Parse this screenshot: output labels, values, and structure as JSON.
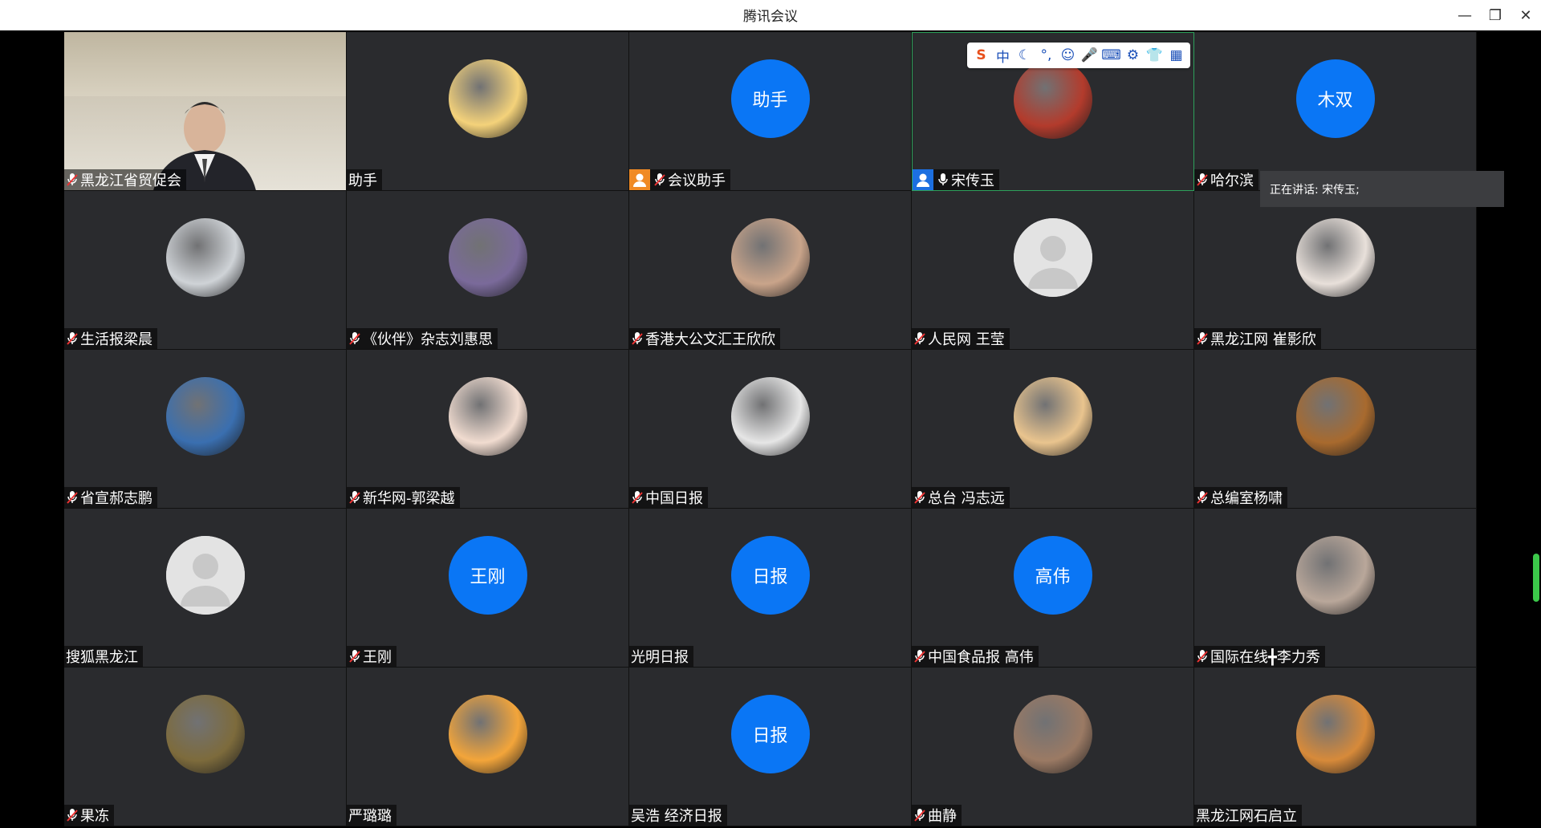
{
  "window": {
    "title": "腾讯会议",
    "controls": {
      "minimize": "—",
      "restore": "❐",
      "close": "✕"
    }
  },
  "speaking": {
    "label": "正在讲话: 宋传玉;"
  },
  "ime": {
    "logo": "S",
    "mode": "中",
    "moon": "☾",
    "punct": "°,",
    "emoji": "☺",
    "voice": "🎤",
    "keyboard": "⌨",
    "tools": "⚙",
    "skin": "👕",
    "more": "▦"
  },
  "participants": [
    {
      "name": "黑龙江省贸促会",
      "avatar": "video",
      "mic": true
    },
    {
      "name": "助手",
      "avatar": "image",
      "color": "#f4d27a",
      "mic": false
    },
    {
      "name": "会议助手",
      "avatar": "text",
      "avatar_text": "助手",
      "mic": true,
      "badge": true
    },
    {
      "name": "宋传玉",
      "avatar": "image",
      "color": "#b33b2c",
      "mic": true,
      "badge": true,
      "active": true
    },
    {
      "name": "哈尔滨",
      "avatar": "text",
      "avatar_text": "木双",
      "mic": true
    },
    {
      "name": "生活报梁晨",
      "avatar": "image",
      "color": "#cfd3d7",
      "mic": true
    },
    {
      "name": "《伙伴》杂志刘惠思",
      "avatar": "image",
      "color": "#7a6a9a",
      "mic": true
    },
    {
      "name": "香港大公文汇王欣欣",
      "avatar": "image",
      "color": "#c9a48a",
      "mic": true
    },
    {
      "name": "人民网 王莹",
      "avatar": "default",
      "mic": true
    },
    {
      "name": "黑龙江网 崔影欣",
      "avatar": "image",
      "color": "#e8e0da",
      "mic": true
    },
    {
      "name": "省宣郝志鹏",
      "avatar": "image",
      "color": "#3a6fb0",
      "mic": true
    },
    {
      "name": "新华网-郭梁越",
      "avatar": "image",
      "color": "#f1dcd0",
      "mic": true
    },
    {
      "name": "中国日报",
      "avatar": "image",
      "color": "#e6e6e6",
      "mic": true
    },
    {
      "name": "总台 冯志远",
      "avatar": "image",
      "color": "#e9c48e",
      "mic": true
    },
    {
      "name": "总编室杨啸",
      "avatar": "image",
      "color": "#a86a2e",
      "mic": true
    },
    {
      "name": "搜狐黑龙江",
      "avatar": "default",
      "mic": false
    },
    {
      "name": "王刚",
      "avatar": "text",
      "avatar_text": "王刚",
      "mic": true
    },
    {
      "name": "光明日报",
      "avatar": "text",
      "avatar_text": "日报",
      "mic": false
    },
    {
      "name": "中国食品报 高伟",
      "avatar": "text",
      "avatar_text": "高伟",
      "mic": true
    },
    {
      "name": "国际在线╋李力秀",
      "avatar": "image",
      "color": "#b9a79a",
      "mic": true
    },
    {
      "name": "果冻",
      "avatar": "image",
      "color": "#7d6b3c",
      "mic": true
    },
    {
      "name": "严璐璐",
      "avatar": "image",
      "color": "#f3a53a",
      "mic": false
    },
    {
      "name": "吴浩 经济日报",
      "avatar": "text",
      "avatar_text": "日报",
      "mic": false
    },
    {
      "name": "曲静",
      "avatar": "image",
      "color": "#9b7a64",
      "mic": true
    },
    {
      "name": "黑龙江网石启立",
      "avatar": "image",
      "color": "#d78a3a",
      "mic": false
    }
  ]
}
